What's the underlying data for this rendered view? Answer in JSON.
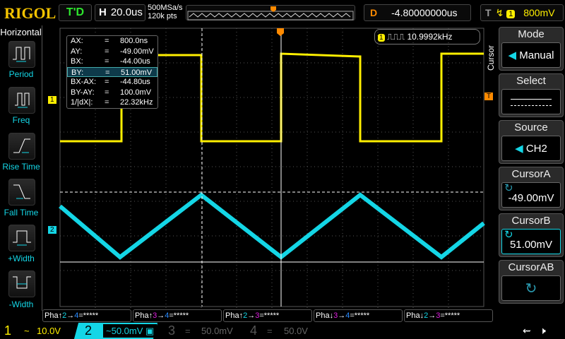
{
  "header": {
    "logo": "RIGOL",
    "run_status": "T'D",
    "timebase_label": "H",
    "timebase": "20.0us",
    "sample_rate": "500MSa/s",
    "memory_depth": "120k pts",
    "delay_label": "D",
    "delay": "-4.80000000us",
    "trigger_label": "T",
    "trigger_channel": "1",
    "trigger_level": "800mV"
  },
  "left_menu": {
    "title": "Horizontal",
    "items": [
      {
        "label": "Period"
      },
      {
        "label": "Freq"
      },
      {
        "label": "Rise Time"
      },
      {
        "label": "Fall Time"
      },
      {
        "label": "+Width"
      },
      {
        "label": "-Width"
      }
    ]
  },
  "measurements": [
    {
      "k": "AX:",
      "eq": "=",
      "v": "800.0ns"
    },
    {
      "k": "AY:",
      "eq": "=",
      "v": "-49.00mV"
    },
    {
      "k": "BX:",
      "eq": "=",
      "v": "-44.00us"
    },
    {
      "k": "BY:",
      "eq": "=",
      "v": "51.00mV"
    },
    {
      "k": "BX-AX:",
      "eq": "=",
      "v": "-44.80us"
    },
    {
      "k": "BY-AY:",
      "eq": "=",
      "v": "100.0mV"
    },
    {
      "k": "1/|dX|:",
      "eq": "=",
      "v": "22.32kHz"
    }
  ],
  "frequency_counter": {
    "channel": "1",
    "value": "10.9992kHz"
  },
  "markers": {
    "ch1": "1",
    "ch2": "2",
    "trigger": "T"
  },
  "right_menu": {
    "tab": "Cursor",
    "items": [
      {
        "title": "Mode",
        "value": "Manual"
      },
      {
        "title": "Select",
        "value": ""
      },
      {
        "title": "Source",
        "value": "CH2"
      },
      {
        "title": "CursorA",
        "value": "-49.00mV"
      },
      {
        "title": "CursorB",
        "value": "51.00mV"
      },
      {
        "title": "CursorAB",
        "value": ""
      }
    ]
  },
  "phase": [
    {
      "p": "Pha",
      "e": "↑",
      "a": "2",
      "b": "4",
      "r": "=*****"
    },
    {
      "p": "Pha",
      "e": "↑",
      "a": "3",
      "b": "4",
      "r": "=*****"
    },
    {
      "p": "Pha",
      "e": "↑",
      "a": "2",
      "b": "3",
      "r": "=*****"
    },
    {
      "p": "Pha",
      "e": "↓",
      "a": "3",
      "b": "4",
      "r": "=*****"
    },
    {
      "p": "Pha",
      "e": "↓",
      "a": "2",
      "b": "3",
      "r": "=*****"
    }
  ],
  "channels": [
    {
      "n": "1",
      "coupling": "~",
      "scale": "10.0V"
    },
    {
      "n": "2",
      "coupling": "~",
      "scale": "50.0mV"
    },
    {
      "n": "3",
      "coupling": "=",
      "scale": "50.0mV"
    },
    {
      "n": "4",
      "coupling": "=",
      "scale": "50.0V"
    }
  ],
  "colors": {
    "ch1": "#ffef00",
    "ch2": "#14d6e6",
    "ch3": "#e020e0",
    "ch4": "#2a8cff",
    "trigger": "#ff8a00"
  }
}
